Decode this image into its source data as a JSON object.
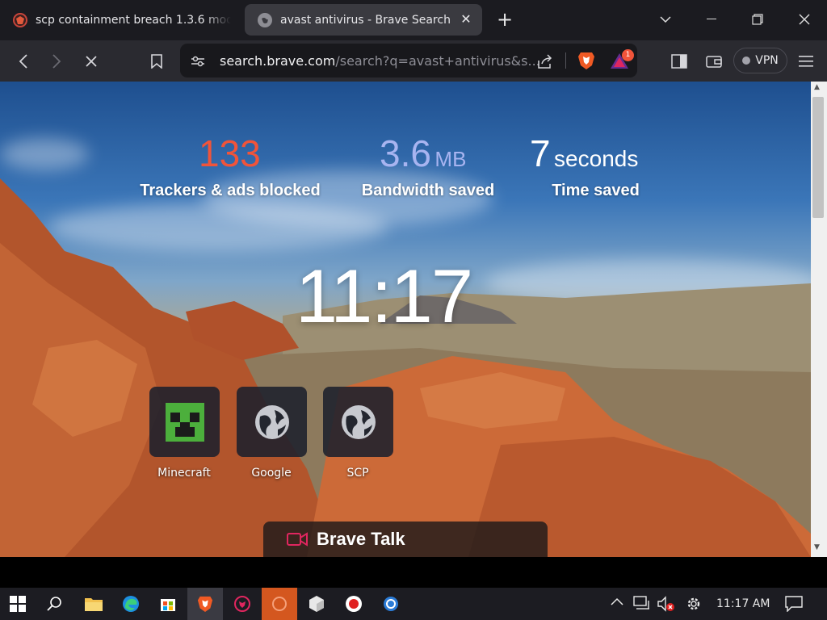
{
  "tabs": [
    {
      "title": "scp containment breach 1.3.6 moddb"
    },
    {
      "title": "avast antivirus - Brave Search"
    }
  ],
  "address_bar": {
    "host": "search.brave.com",
    "path": "/search?q=avast+antivirus&s..."
  },
  "toolbar": {
    "vpn_label": "VPN",
    "rewards_badge": "1"
  },
  "stats": {
    "trackers": {
      "value": "133",
      "label": "Trackers & ads blocked",
      "color": "#f0543a"
    },
    "bandwidth": {
      "value": "3.6",
      "unit": "MB",
      "label": "Bandwidth saved",
      "color": "#a8b4f0"
    },
    "time": {
      "value": "7",
      "unit": "seconds",
      "label": "Time saved"
    }
  },
  "clock": "11:17",
  "top_sites": [
    {
      "label": "Minecraft",
      "icon": "minecraft-icon"
    },
    {
      "label": "Google",
      "icon": "globe-icon"
    },
    {
      "label": "SCP",
      "icon": "globe-icon"
    }
  ],
  "brave_talk": {
    "label": "Brave Talk"
  },
  "taskbar": {
    "time": "11:17 AM"
  }
}
